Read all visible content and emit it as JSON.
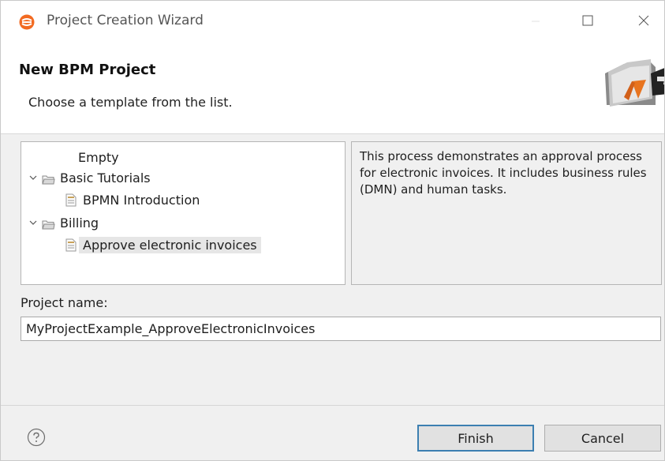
{
  "window": {
    "title": "Project Creation Wizard",
    "controls": [
      "minimize",
      "maximize",
      "close"
    ]
  },
  "banner": {
    "title": "New BPM Project",
    "subtitle": "Choose a template from the list."
  },
  "tree": {
    "items": [
      {
        "label": "Empty",
        "type": "item",
        "depth": 0,
        "selected": false
      },
      {
        "label": "Basic Tutorials",
        "type": "folder",
        "expanded": true,
        "depth": 0
      },
      {
        "label": "BPMN Introduction",
        "type": "file",
        "depth": 1,
        "selected": false
      },
      {
        "label": "Billing",
        "type": "folder",
        "expanded": true,
        "depth": 0
      },
      {
        "label": "Approve electronic invoices",
        "type": "file",
        "depth": 1,
        "selected": true
      }
    ]
  },
  "description": {
    "text": "This process demonstrates an approval process for electronic invoices. It includes business rules (DMN) and human tasks."
  },
  "project_name": {
    "label": "Project name:",
    "value": "MyProjectExample_ApproveElectronicInvoices"
  },
  "footer": {
    "finish_label": "Finish",
    "cancel_label": "Cancel"
  },
  "colors": {
    "accent_border": "#3c7fb1",
    "app_icon": "#f26a21"
  }
}
